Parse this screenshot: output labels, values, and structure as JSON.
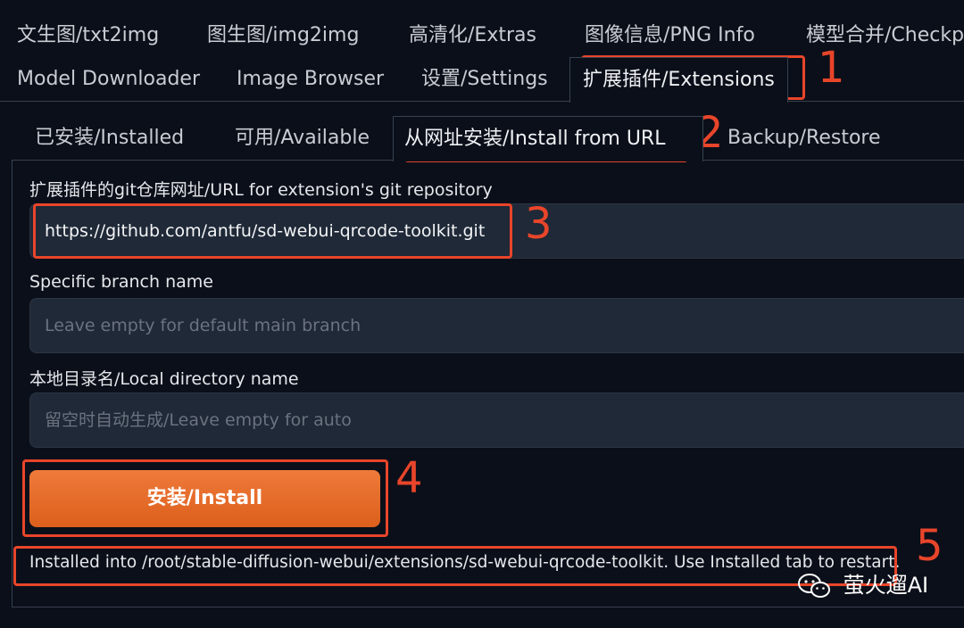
{
  "main_tabs": {
    "row1": [
      "文生图/txt2img",
      "图生图/img2img",
      "高清化/Extras",
      "图像信息/PNG Info",
      "模型合并/Checkp"
    ],
    "row2": [
      "Model Downloader",
      "Image Browser",
      "设置/Settings",
      "扩展插件/Extensions"
    ],
    "active": "扩展插件/Extensions"
  },
  "extension_tabs": {
    "items": [
      "已安装/Installed",
      "可用/Available",
      "从网址安装/Install from URL",
      "Backup/Restore"
    ],
    "active": "从网址安装/Install from URL"
  },
  "form": {
    "url_label": "扩展插件的git仓库网址/URL for extension's git repository",
    "url_value": "https://github.com/antfu/sd-webui-qrcode-toolkit.git",
    "branch_label": "Specific branch name",
    "branch_placeholder": "Leave empty for default main branch",
    "dir_label": "本地目录名/Local directory name",
    "dir_placeholder": "留空时自动生成/Leave empty for auto",
    "install_button": "安装/Install",
    "status": "Installed into /root/stable-diffusion-webui/extensions/sd-webui-qrcode-toolkit. Use Installed tab to restart."
  },
  "annotations": {
    "color": "#e8452a",
    "numbers": [
      "1",
      "2",
      "3",
      "4",
      "5"
    ]
  },
  "watermark": {
    "text": "萤火遛AI",
    "icon": "wechat-icon"
  }
}
